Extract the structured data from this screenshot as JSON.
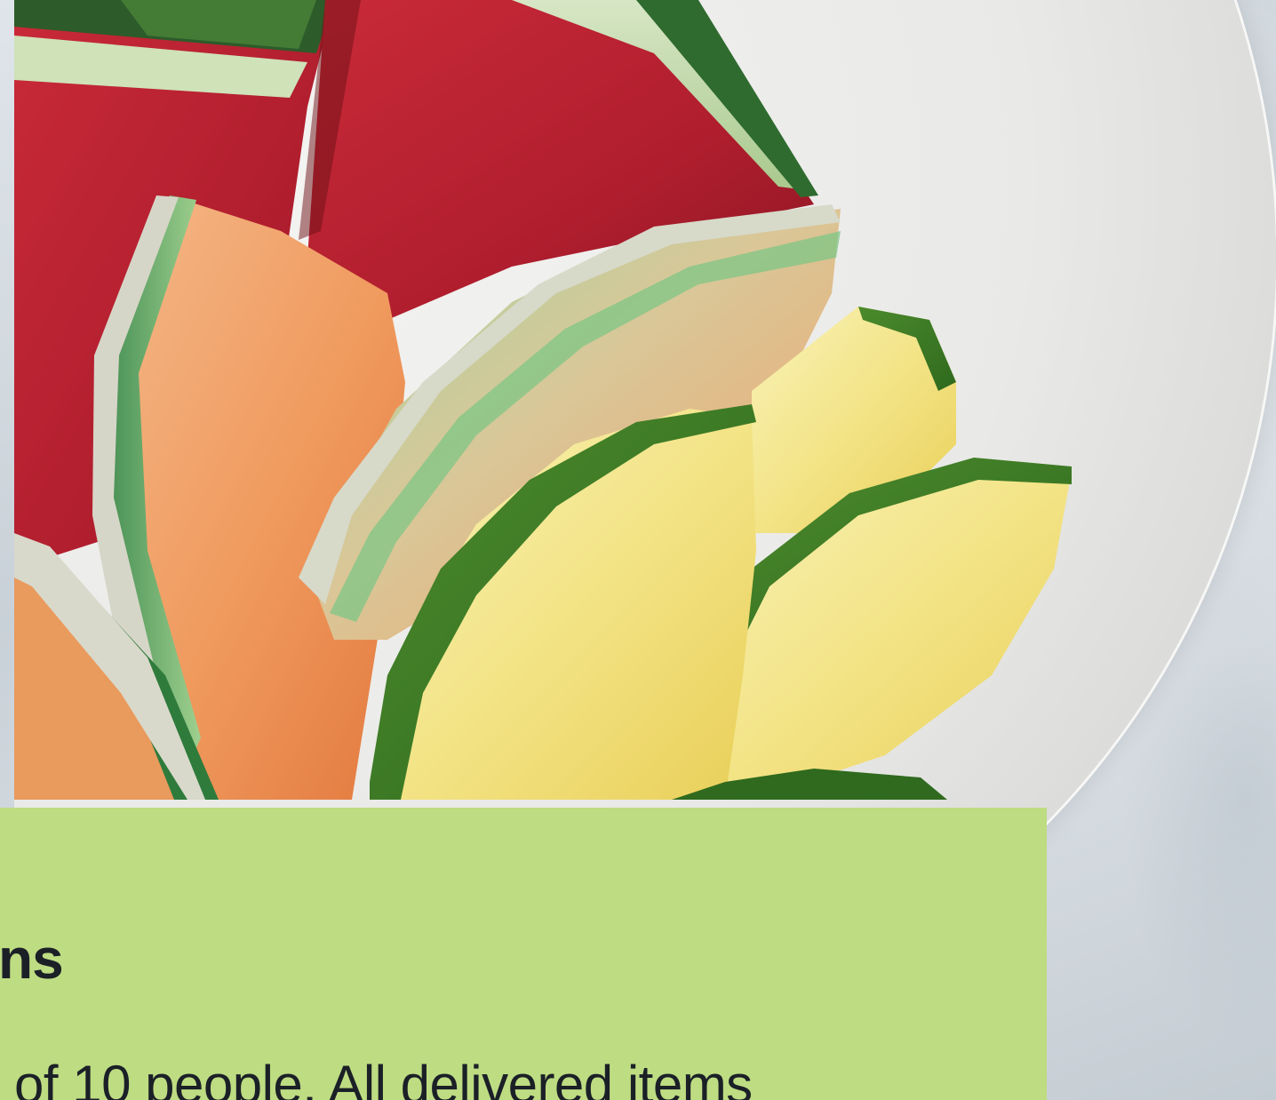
{
  "hero": {
    "image_alt": "Bowl of sliced watermelon, cantaloupe and pineapple"
  },
  "panel": {
    "title": "ns",
    "body": "of 10 people. All delivered items",
    "background_color": "#bedc82",
    "text_color": "#1b2027"
  }
}
